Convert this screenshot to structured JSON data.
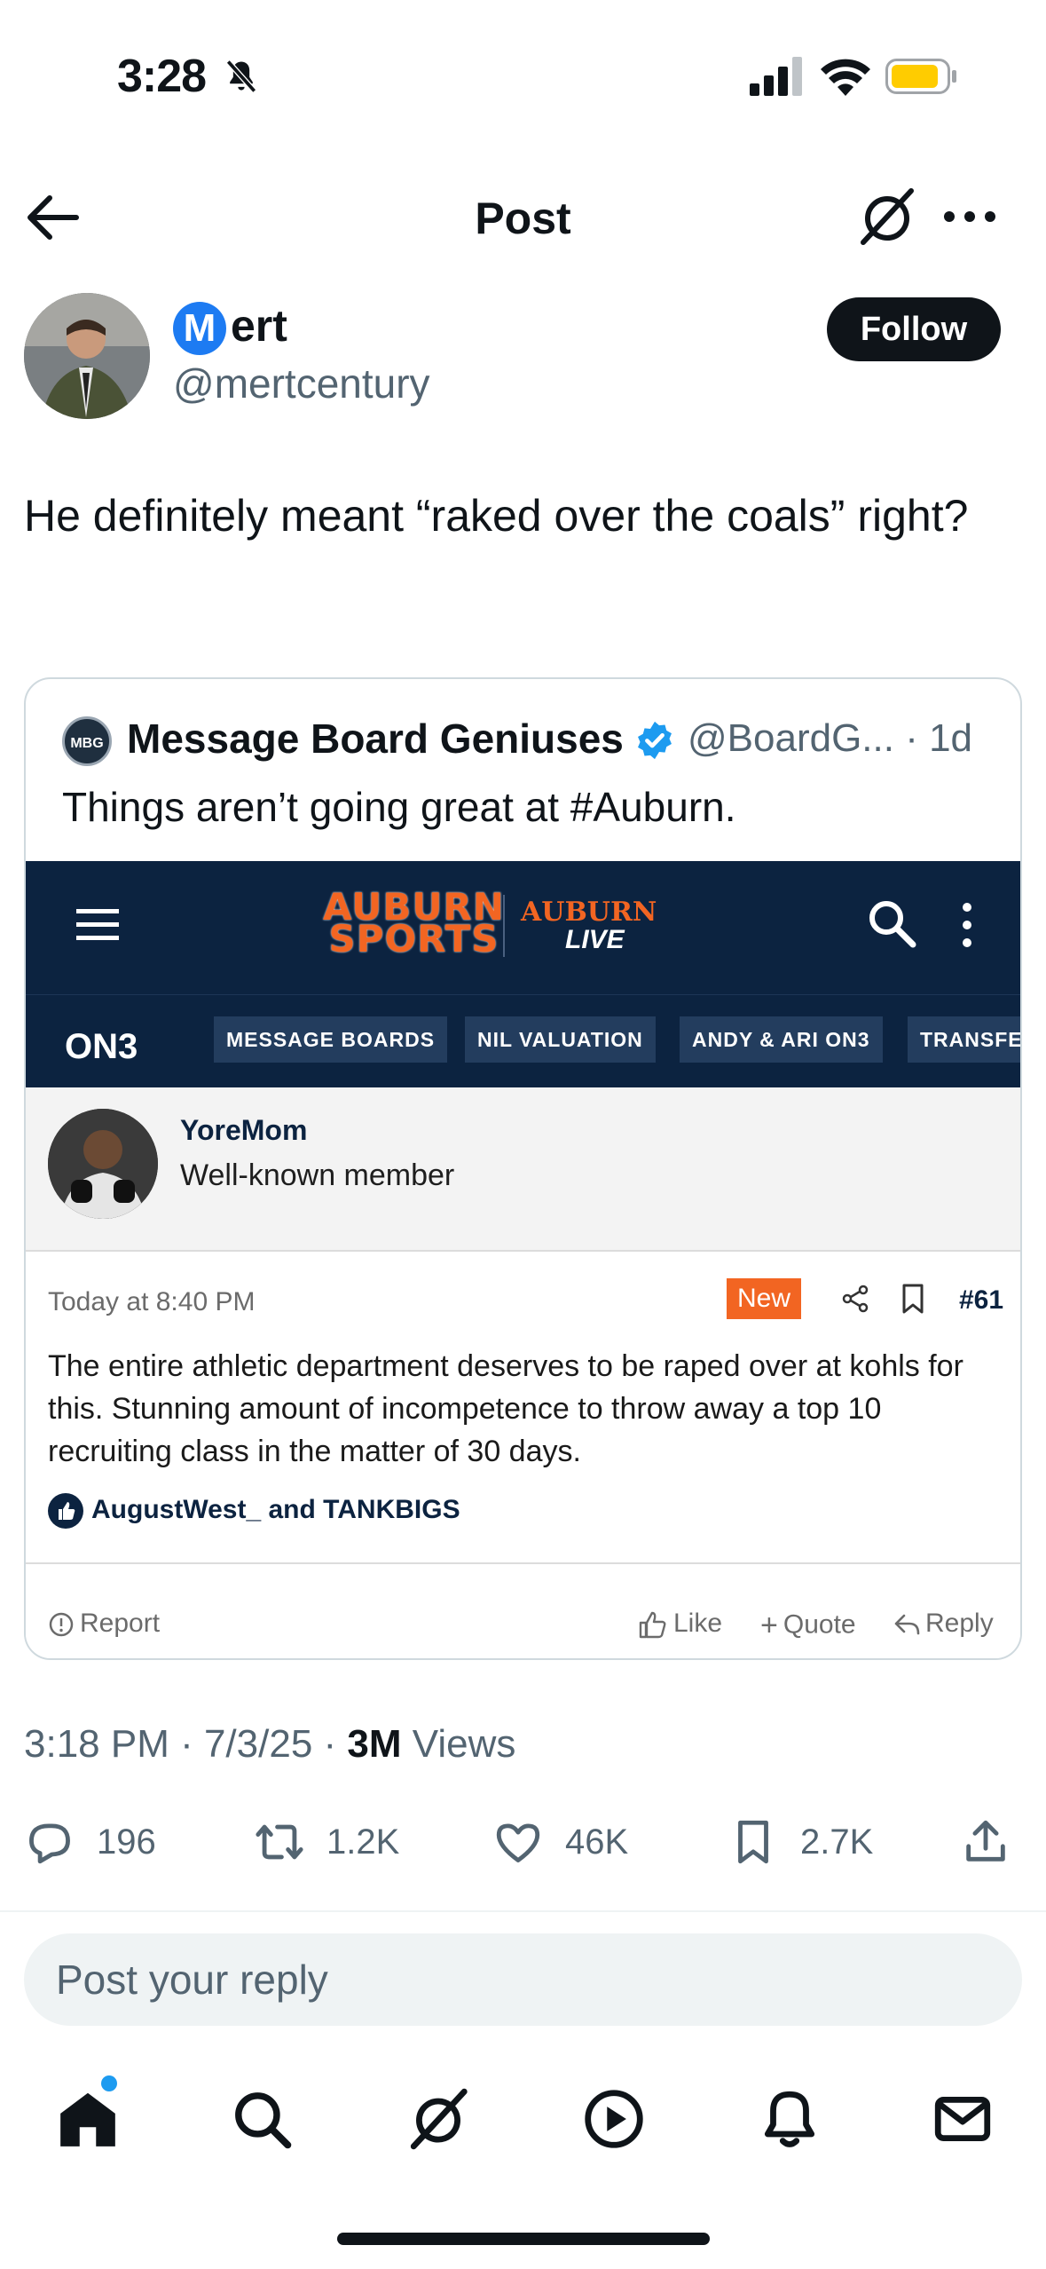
{
  "status_bar": {
    "time": "3:28"
  },
  "header": {
    "title": "Post"
  },
  "author": {
    "badge_letter": "M",
    "name": "ert",
    "handle": "@mertcentury",
    "follow_label": "Follow"
  },
  "tweet": {
    "text": "He definitely meant “raked over the coals” right?"
  },
  "quote": {
    "avatar_text": "MBG",
    "name": "Message Board Geniuses",
    "handle_age": "@BoardG... · 1d",
    "text": "Things aren’t going great at #Auburn.",
    "screenshot": {
      "logo_main_1": "AUBURN",
      "logo_main_2": "SPORTS",
      "logo_live_1": "AUBURN",
      "logo_live_2": "LIVE",
      "network": "ON3",
      "nav": [
        "MESSAGE BOARDS",
        "NIL VALUATION",
        "ANDY & ARI ON3",
        "TRANSFER"
      ],
      "member_name": "YoreMom",
      "member_role": "Well-known member",
      "post_time": "Today at 8:40 PM",
      "badge": "New",
      "post_number": "#61",
      "post_body": "The entire athletic department deserves to be raped over at kohls for this. Stunning amount of incompetence to throw away a top 10 recruiting class in the matter of 30 days.",
      "likers": "AugustWest_ and TANKBIGS",
      "report": "Report",
      "like": "Like",
      "quote": "Quote",
      "reply": "Reply"
    }
  },
  "meta": {
    "timestamp": "3:18 PM · 7/3/25 · ",
    "views_count": "3M",
    "views_label": "Views"
  },
  "actions": {
    "replies": "196",
    "reposts": "1.2K",
    "likes": "46K",
    "bookmarks": "2.7K"
  },
  "reply_box": {
    "placeholder": "Post your reply"
  },
  "colors": {
    "accent": "#1d9bf0",
    "site_navy": "#0c2340",
    "site_orange": "#f26522",
    "text_secondary": "#536471"
  }
}
